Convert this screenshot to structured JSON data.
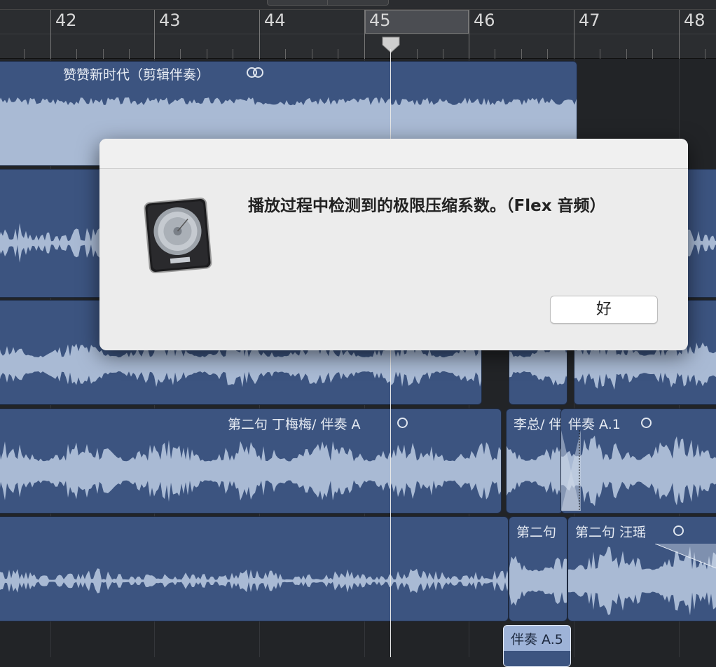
{
  "ruler": {
    "bars": [
      "42",
      "43",
      "44",
      "45",
      "46",
      "47",
      "48"
    ]
  },
  "regions": [
    {
      "name": "赞赞新时代（剪辑伴奏）",
      "loop": true
    },
    {
      "name": "第二句 丁梅梅/ 伴奏 A",
      "loop": true
    },
    {
      "name": "李总/ 伴",
      "loop": false
    },
    {
      "name": "伴奏 A.1",
      "loop": true
    },
    {
      "name": "第二句",
      "loop": false
    },
    {
      "name": "第二句 汪瑶",
      "loop": true
    },
    {
      "name": "伴奏 A.5",
      "loop": false
    }
  ],
  "dialog": {
    "message": "播放过程中检测到的极限压缩系数。（Flex 音频）",
    "ok_label": "好",
    "icon": "logic-pro-icon"
  },
  "colors": {
    "region": "#3c5480",
    "waveform": "#a9bad4",
    "background": "#222427",
    "dialog": "#ececec"
  }
}
